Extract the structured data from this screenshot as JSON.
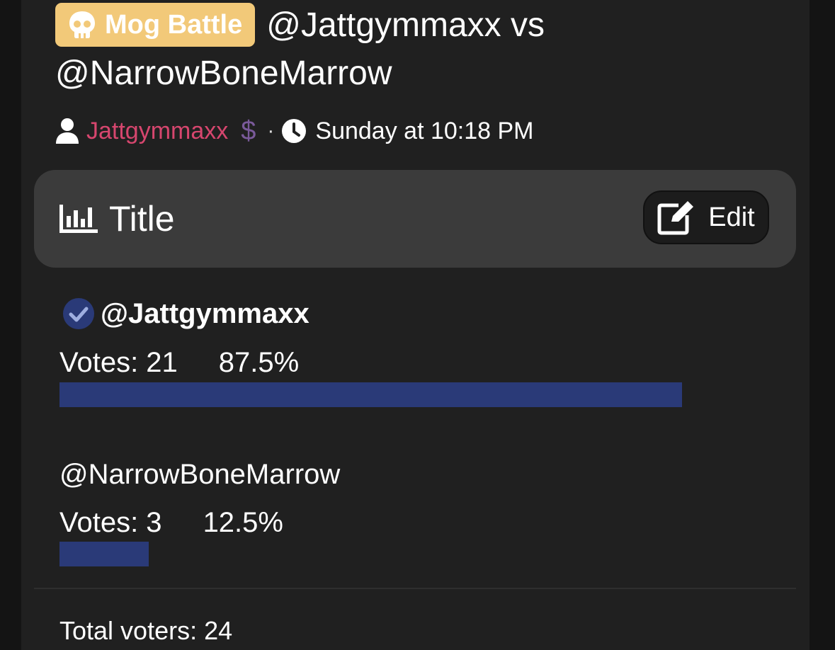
{
  "thread": {
    "prefix_label": "Mog Battle",
    "prefix_icon": "skull-icon",
    "title_line1": "@Jattgymmaxx vs",
    "title_line2": "@NarrowBoneMarrow",
    "author": "Jattgymmaxx",
    "author_badge": "$",
    "separator": "·",
    "date": "Sunday at 10:18 PM"
  },
  "poll": {
    "title": "Title",
    "edit_label": "Edit",
    "options": [
      {
        "name": "@Jattgymmaxx",
        "votes_text": "Votes: 21",
        "percent_text": "87.5%",
        "fraction": 0.875,
        "voted": true
      },
      {
        "name": "@NarrowBoneMarrow",
        "votes_text": "Votes: 3",
        "percent_text": "12.5%",
        "fraction": 0.125,
        "voted": false
      }
    ],
    "total_voters": "Total voters: 24"
  },
  "colors": {
    "background": "#141414",
    "panel": "#202020",
    "poll_header": "#3b3b3b",
    "prefix_badge": "#f2c979",
    "author": "#d6466e",
    "bar": "#2a3a78",
    "check": "#2a3a78",
    "text": "#ffffff"
  }
}
